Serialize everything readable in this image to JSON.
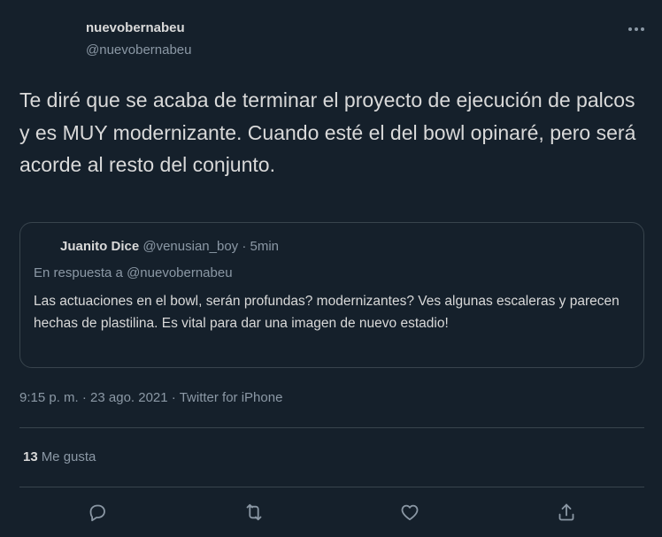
{
  "tweet": {
    "author_name": "nuevobernabeu",
    "author_handle": "@nuevobernabeu",
    "more_icon": "more-horizontal-icon",
    "text": "Te diré que se acaba de terminar el proyecto de ejecución de palcos y es MUY modernizante. Cuando esté el del bowl opinaré, pero será acorde al resto del conjunto.",
    "timestamp": "9:15 p. m. · 23 ago. 2021 · ",
    "source": "Twitter for iPhone"
  },
  "quote": {
    "name": "Juanito Dice",
    "meta": "@venusian_boy · 5min",
    "reply_to": "En respuesta a @nuevobernabeu",
    "text": "Las actuaciones en el bowl, serán profundas? modernizantes? Ves algunas escaleras y parecen hechas de plastilina. Es vital para dar una imagen de nuevo estadio!"
  },
  "stats": {
    "likes_count": "13",
    "likes_label": "Me gusta"
  },
  "actions": [
    {
      "name": "reply",
      "icon": "reply-icon"
    },
    {
      "name": "retweet",
      "icon": "retweet-icon"
    },
    {
      "name": "like",
      "icon": "heart-icon"
    },
    {
      "name": "share",
      "icon": "share-icon"
    }
  ],
  "colors": {
    "background": "#15202b",
    "text": "#d9d9d9",
    "secondary": "#8b98a5",
    "border": "#38444d"
  }
}
